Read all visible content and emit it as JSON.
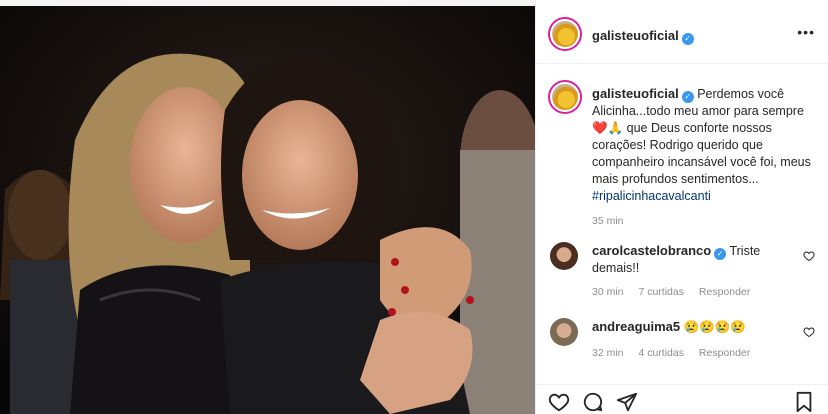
{
  "post": {
    "username": "galisteuoficial",
    "more_icon": "more-horizontal-icon",
    "verified_icon": "verified-badge-icon",
    "caption_text": "Perdemos você Alicinha...todo meu amor para sempre",
    "caption_emojis": "❤️🙏",
    "caption_text_2": "que Deus conforte nossos corações! Rodrigo querido que companheiro incansável você foi, meus mais profundos sentimentos...",
    "hashtag": "#ripalicinhacavalcanti",
    "time": "35 min"
  },
  "comments": [
    {
      "username": "carolcastelobranco",
      "text": "Triste demais!!",
      "time": "30 min",
      "likes": "7 curtidas",
      "reply": "Responder"
    },
    {
      "username": "andreaguima5",
      "text": "😢😢😢😢",
      "time": "32 min",
      "likes": "4 curtidas",
      "reply": "Responder"
    }
  ],
  "actions": {
    "icons": [
      "heart-icon",
      "comment-icon",
      "share-icon",
      "bookmark-icon"
    ]
  },
  "colors": {
    "verified": "#3897f0",
    "story_ring": "#d6249f",
    "hashtag": "#00376b",
    "heart_emoji": "#c0161b"
  }
}
